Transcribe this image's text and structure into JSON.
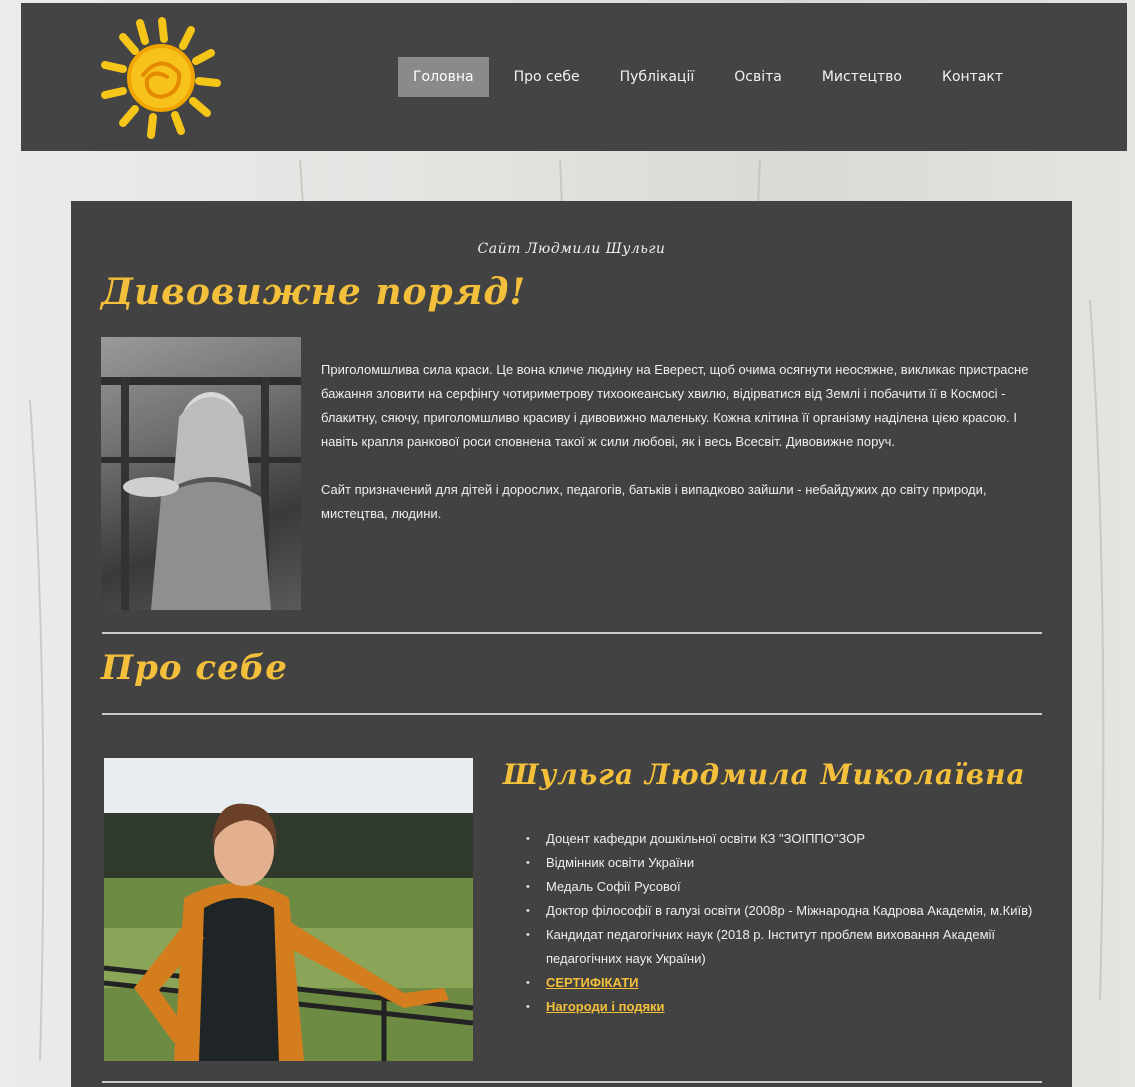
{
  "nav": {
    "items": [
      "Головна",
      "Про себе",
      "Публікації",
      "Освіта",
      "Мистецтво",
      "Контакт"
    ],
    "active_index": 0
  },
  "tagline": "Сайт Людмили Шульги",
  "section1": {
    "heading": "Дивовижне поряд!",
    "paragraph1": "Приголомшлива сила краси. Це вона кличе людину на Еверест, щоб очима осягнути неосяжне, викликає пристрасне бажання зловити на серфінгу чотириметрову тихоокеанську хвилю, відірватися від Землі і побачити її в Космосі - блакитну, сяючу, приголомшливо красиву і дивовижно маленьку. Кожна клітина її організму наділена цією красою. І навіть крапля ранкової роси сповнена такої ж сили любові, як і весь Всесвіт. Дивовижне поруч.",
    "paragraph2": "Сайт призначений для дітей і дорослих, педагогів, батьків і випадково зайшли - небайдужих до світу природи, мистецтва, людини."
  },
  "section2": {
    "heading": "Про себе",
    "name": "Шульга Людмила Миколаївна",
    "bio_items": [
      "Доцент кафедри дошкільної освіти КЗ \"ЗОІППО\"ЗОР",
      "Відмінник освіти України",
      "Медаль Софії Русової",
      "Доктор філософії в галузі освіти  (2008р - Міжнародна Кадрова Академія, м.Київ)",
      "Кандидат педагогічних  наук (2018 р. Інститут проблем виховання Академії педагогічних наук України)"
    ],
    "links": [
      "СЕРТИФІКАТИ",
      "Нагороди і подяки"
    ]
  },
  "colors": {
    "header_bg": "#444444",
    "content_bg": "#424242",
    "accent": "#f4c03c",
    "nav_active_bg": "#8a8a8a"
  },
  "icons": [
    "sun-logo-icon"
  ]
}
